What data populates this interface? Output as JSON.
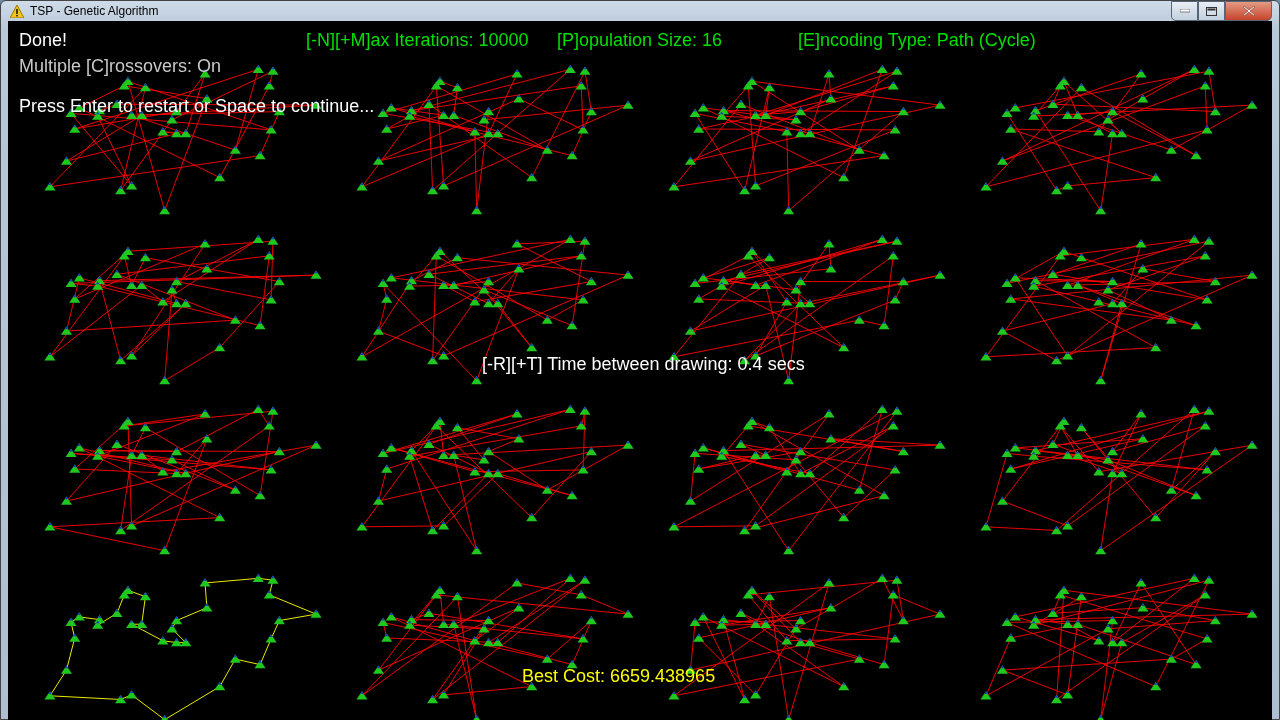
{
  "window": {
    "title": "TSP - Genetic Algorithm"
  },
  "status": {
    "message": "Done!",
    "crossovers": "Multiple [C]rossovers: On",
    "prompt": "Press Enter to restart or Space to continue..."
  },
  "settings": [
    "[-N][+M]ax Iterations: 10000",
    "[P]opulation Size: 16",
    "[E]ncoding Type: Path (Cycle)"
  ],
  "timing": "[-R][+T] Time between drawing: 0.4 secs",
  "best_cost": "Best Cost: 6659.438965",
  "tours": [
    {
      "best": false
    },
    {
      "best": false
    },
    {
      "best": false
    },
    {
      "best": false
    },
    {
      "best": false
    },
    {
      "best": false
    },
    {
      "best": false
    },
    {
      "best": false
    },
    {
      "best": false
    },
    {
      "best": false
    },
    {
      "best": false
    },
    {
      "best": false
    },
    {
      "best": true
    },
    {
      "best": false
    },
    {
      "best": false
    },
    {
      "best": false
    }
  ]
}
